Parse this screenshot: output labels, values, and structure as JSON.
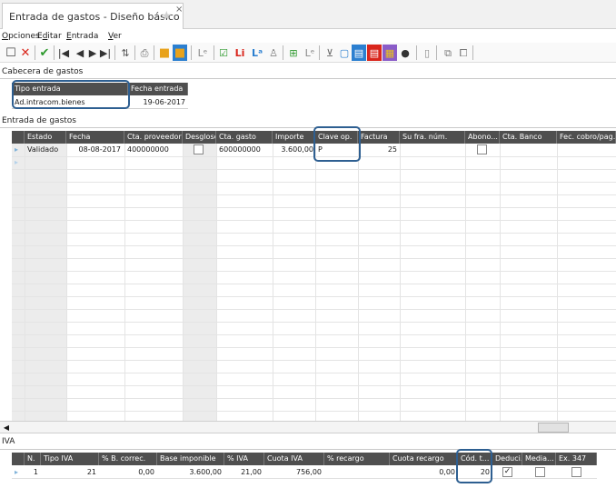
{
  "tab": {
    "title": "Entrada de gastos - Diseño básico",
    "close": "×"
  },
  "menu": [
    {
      "first": "O",
      "rest": "pciones"
    },
    {
      "first": "E",
      "rest": "ditar",
      "prefix": ""
    },
    {
      "first": "E",
      "rest": "ntrada"
    },
    {
      "first": "V",
      "rest": "er"
    }
  ],
  "menu_text": [
    "Opciones",
    "Editar",
    "Entrada",
    "Ver"
  ],
  "toolbar": {
    "icons": [
      "new-document-icon",
      "delete-icon",
      "confirm-icon",
      "first-record-icon",
      "previous-record-icon",
      "next-record-icon",
      "last-record-icon",
      "sort-icon",
      "print-icon",
      "folder-open-icon",
      "folder-card-icon",
      "ledger-icon",
      "document-check-icon",
      "ledger-red-icon",
      "ledger-blue-icon",
      "ledger-group-icon",
      "grid-add-icon",
      "ledger-green-icon",
      "filter-icon",
      "document-icon",
      "report-blue-icon",
      "report-red-icon",
      "color-icon",
      "user-icon",
      "page-icon",
      "attach-icon",
      "copy-icon"
    ]
  },
  "header_section": {
    "title": "Cabecera de gastos",
    "columns": [
      "Tipo entrada",
      "Fecha entrada"
    ],
    "row": {
      "tipo_entrada": "Ad.intracom.bienes",
      "fecha_entrada": "19-06-2017"
    }
  },
  "entries_section": {
    "title": "Entrada de gastos",
    "columns": [
      "Estado",
      "Fecha",
      "Cta. proveedor",
      "Desglose",
      "Cta. gasto",
      "Importe",
      "Clave op.",
      "Factura",
      "Su fra. núm.",
      "Abono...",
      "Cta. Banco",
      "Fec. cobro/pag."
    ],
    "rows": [
      {
        "estado": "Validado",
        "fecha": "08-08-2017",
        "cta_proveedor": "400000000",
        "desglose": false,
        "cta_gasto": "600000000",
        "importe": "3.600,00",
        "clave_op": "P",
        "factura": "25",
        "su_fra": "",
        "abono": false,
        "cta_banco": "",
        "fec_cobro": ""
      }
    ]
  },
  "iva_section": {
    "title": "IVA",
    "columns": [
      "N.",
      "Tipo IVA",
      "% B. correc.",
      "Base imponible",
      "% IVA",
      "Cuota IVA",
      "% recargo",
      "Cuota recargo",
      "Cód. t...",
      "Deduci...",
      "Media...",
      "Ex. 347"
    ],
    "rows": [
      {
        "n": "1",
        "tipo_iva": "21",
        "b_correc": "0,00",
        "base": "3.600,00",
        "pct_iva": "21,00",
        "cuota_iva": "756,00",
        "recargo": "",
        "cuota_recargo": "0,00",
        "cod_t": "20",
        "deducible": true,
        "media": false,
        "ex347": false
      }
    ]
  },
  "colors": {
    "header_bg": "#4f4f4f",
    "annotation": "#2e5f91",
    "row_indicator": "#7fb2d9"
  }
}
